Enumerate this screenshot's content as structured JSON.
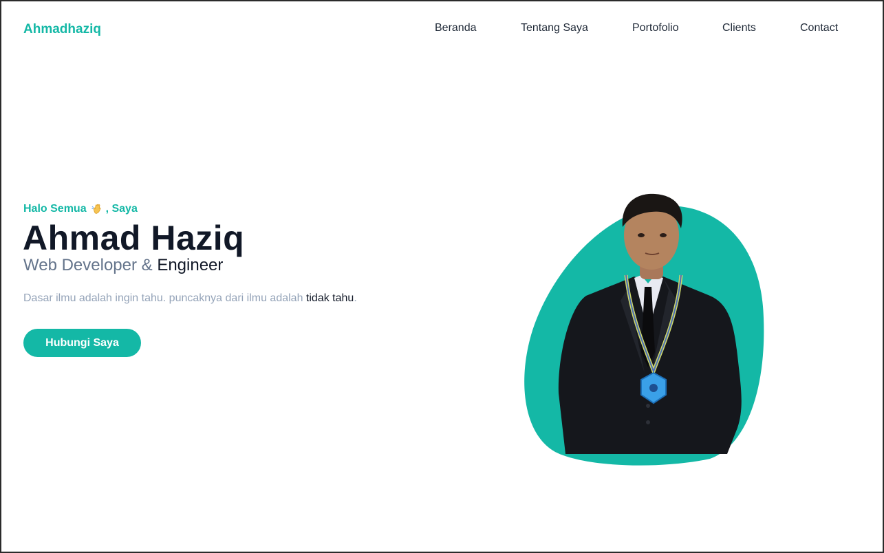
{
  "nav": {
    "brand": "Ahmadhaziq",
    "links": [
      "Beranda",
      "Tentang Saya",
      "Portofolio",
      "Clients",
      "Contact"
    ]
  },
  "hero": {
    "greeting_prefix": "Halo Semua",
    "greeting_icon": "waving-hand-icon",
    "greeting_suffix": ", Saya",
    "name": "Ahmad Haziq",
    "role_part1": "Web Developer & ",
    "role_part2": "Engineer",
    "quote_part1": "Dasar ilmu adalah ingin tahu. puncaknya dari ilmu adalah ",
    "quote_part2": "tidak tahu",
    "quote_part3": ".",
    "cta_label": "Hubungi Saya"
  },
  "colors": {
    "accent": "#14b8a6",
    "heading": "#111827",
    "muted": "#64748b",
    "light_muted": "#94a3b8"
  }
}
